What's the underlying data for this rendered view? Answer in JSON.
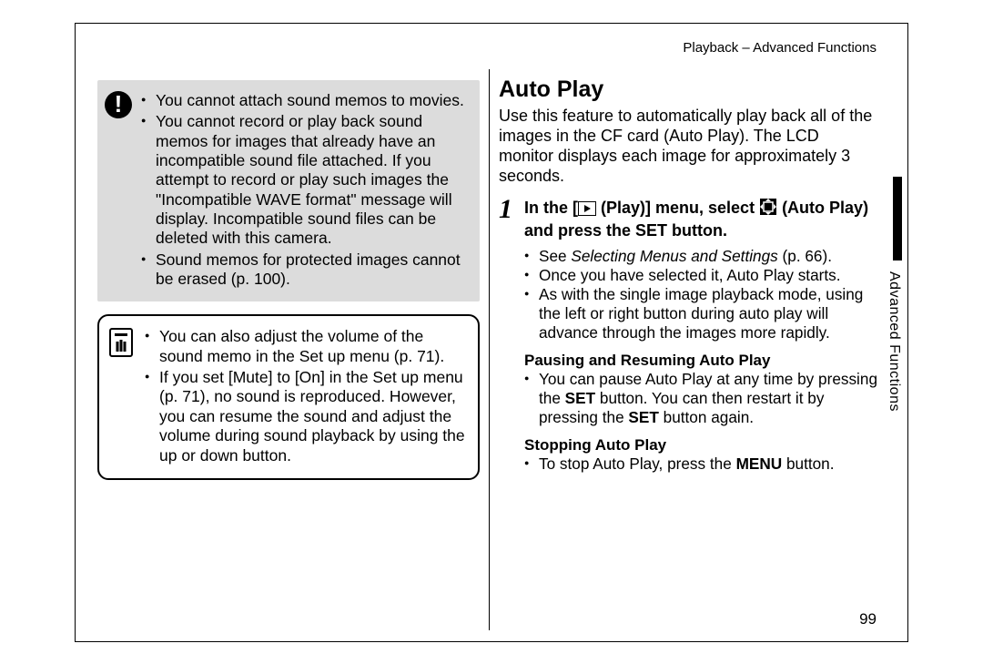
{
  "header": "Playback – Advanced Functions",
  "page_number": "99",
  "side_tab": "Advanced Functions",
  "left": {
    "warn": [
      "You cannot attach sound memos to movies.",
      "You cannot record or play back sound memos for images that already have an incompatible sound file attached. If you attempt to record or play such images the \"Incompatible WAVE format\" message will display. Incompatible sound files can be deleted with this camera.",
      "Sound memos for protected images cannot be erased (p. 100)."
    ],
    "note": [
      "You can also adjust the volume of the sound memo in the Set up menu (p. 71).",
      "If you set [Mute] to [On] in the Set up menu (p. 71), no sound is reproduced. However, you can resume the sound and adjust the volume during sound playback by using the up or down button."
    ]
  },
  "right": {
    "title": "Auto Play",
    "intro": "Use this feature to automatically play back all of the images in the CF card (Auto Play). The LCD monitor displays each image for approximately 3 seconds.",
    "step_pre": "In the [",
    "step_mid": " (Play)] menu, select ",
    "step_post": " (Auto Play) and press the SET button.",
    "b1a": "See ",
    "b1b": "Selecting Menus and Settings",
    "b1c": " (p. 66).",
    "b2": "Once you have selected it, Auto Play starts.",
    "b3": "As with the single image playback mode, using the left or right button during auto play will advance through the images more rapidly.",
    "sub1": "Pausing and Resuming Auto Play",
    "s1a": "You can pause Auto Play at any time by pressing the ",
    "s1b": "SET",
    "s1c": " button. You can then restart it by pressing the ",
    "s1d": "SET",
    "s1e": " button again.",
    "sub2": "Stopping Auto Play",
    "s2a": "To stop Auto Play, press the ",
    "s2b": "MENU",
    "s2c": " button."
  }
}
